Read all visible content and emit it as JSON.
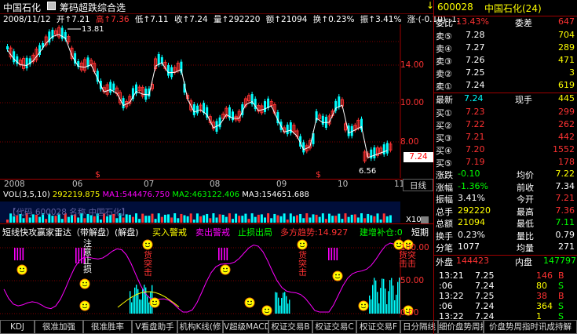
{
  "header": {
    "stock_name": "中国石化",
    "tool_label": "筹码超跌综合选",
    "arrow": "↓"
  },
  "ohlc": {
    "date": "2008/11/12",
    "open": "开↑7.21",
    "high": "高↑7.36",
    "low": "低↑7.11",
    "close": "收↑7.24",
    "volume": "量↑292220",
    "amount": "额↑21094",
    "turnover": "换↑0.23%",
    "amplitude": "振↑3.41%",
    "change": "涨·(-0.10)·-1."
  },
  "price_axis": [
    "14.00",
    "12.00",
    "10.00",
    "8.00"
  ],
  "current_price_tag": "7.24",
  "chart_annotations": {
    "high": "13.81",
    "low": "6.56"
  },
  "month_labels": [
    "2008",
    "06",
    "07",
    "08",
    "09",
    "10",
    "11"
  ],
  "daily_button": "日线",
  "vol_line": {
    "label": "VOL(3,5,10)",
    "vol": "292219.875",
    "ma1": "MA1:544476.750",
    "ma2": "MA2:463122.406",
    "ma3": "MA3:154651.688"
  },
  "vol_overlay_text": "【代码 600028 名称 中国石化】",
  "x10_label": "X10",
  "indicator": {
    "name": "短线快攻赢家雷达（带解盘）(解盘)",
    "buy": "买入警戒",
    "sell": "卖出警戒",
    "stop": "止损出局",
    "trend": "多方趋势:14.927",
    "add": "建增补仓:0",
    "short": "短期"
  },
  "indicator_axis": [
    "100.00",
    "50.00",
    "0.00"
  ],
  "indicator_texts": {
    "t1": "注意止损",
    "t2": "货突击",
    "t3": "货突击",
    "t4": "货突击击"
  },
  "bottom_tabs": [
    "KDJ",
    "很准加强",
    "很准胜率",
    "V看盘助手",
    "机构K线(修",
    "V超级MACD",
    "权证交易B",
    "权证交易C",
    "权证交易F",
    "日分隔线",
    "细价盘势周指"
  ],
  "right_panel": {
    "code": "600028",
    "name": "中国石化(24)",
    "webi_label": "委比",
    "webi_val": "13.43%",
    "weicha_label": "委差",
    "weicha_val": "647",
    "sells": [
      {
        "label": "卖⑤",
        "price": "7.28",
        "vol": "704"
      },
      {
        "label": "卖④",
        "price": "7.27",
        "vol": "289"
      },
      {
        "label": "卖③",
        "price": "7.26",
        "vol": "471"
      },
      {
        "label": "卖②",
        "price": "7.25",
        "vol": "3"
      },
      {
        "label": "卖①",
        "price": "7.24",
        "vol": "619"
      }
    ],
    "latest_label": "最新",
    "latest_val": "7.24",
    "xianshou_label": "现手",
    "xianshou_val": "445",
    "buys": [
      {
        "label": "买①",
        "price": "7.23",
        "vol": "299"
      },
      {
        "label": "买②",
        "price": "7.22",
        "vol": "262"
      },
      {
        "label": "买③",
        "price": "7.21",
        "vol": "442"
      },
      {
        "label": "买④",
        "price": "7.20",
        "vol": "1552"
      },
      {
        "label": "买⑤",
        "price": "7.19",
        "vol": "178"
      }
    ],
    "stats": [
      {
        "l1": "涨跌",
        "v1": "-0.10",
        "l2": "均价",
        "v2": "7.22"
      },
      {
        "l1": "涨幅",
        "v1": "-1.36%",
        "l2": "前收",
        "v2": "7.34"
      },
      {
        "l1": "振幅",
        "v1": "3.41%",
        "l2": "今开",
        "v2": "7.21"
      },
      {
        "l1": "总手",
        "v1": "292220",
        "l2": "最高",
        "v2": "7.36"
      },
      {
        "l1": "总额",
        "v1": "21094",
        "l2": "最低",
        "v2": "7.11"
      },
      {
        "l1": "换手",
        "v1": "0.23%",
        "l2": "量比",
        "v2": "0.79"
      },
      {
        "l1": "分笔",
        "v1": "1077",
        "l2": "均量",
        "v2": "271"
      }
    ],
    "waipan_label": "外盘",
    "waipan_val": "144423",
    "neipan_label": "内盘",
    "neipan_val": "147797",
    "ticks": [
      {
        "time": "13:21",
        "price": "7.25",
        "vol": "146",
        "dir": "B"
      },
      {
        "time": ":06",
        "price": "7.24",
        "vol": "80",
        "dir": "S"
      },
      {
        "time": "13:22",
        "price": "7.25",
        "vol": "38",
        "dir": "B"
      },
      {
        "time": ":06",
        "price": "7.24",
        "vol": "364",
        "dir": "S"
      },
      {
        "time": "13:22",
        "price": "7.24",
        "vol": "1",
        "dir": "S"
      }
    ],
    "bottom_text": "价盘势周指时讯成持解"
  },
  "colors": {
    "up": "#ff3232",
    "down": "#00ffff",
    "bg": "#000000"
  }
}
